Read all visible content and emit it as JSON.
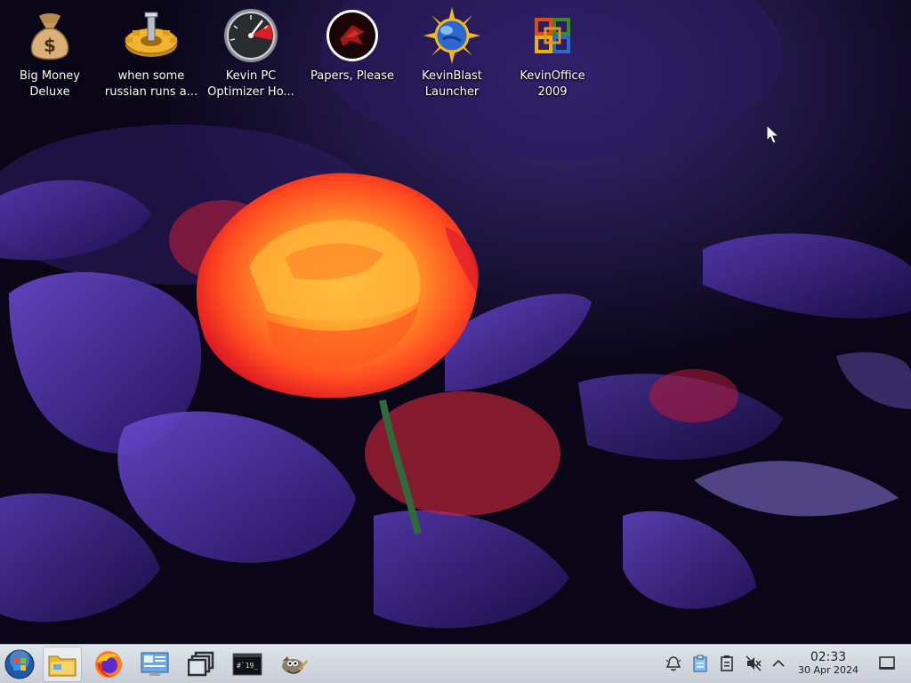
{
  "desktop": {
    "icons": [
      {
        "label": "Big Money\nDeluxe",
        "icon": "money-bag-icon"
      },
      {
        "label": "when some\nrussian runs a...",
        "icon": "gear-icon"
      },
      {
        "label": "Kevin PC\nOptimizer Ho...",
        "icon": "gauge-icon"
      },
      {
        "label": "Papers, Please",
        "icon": "seal-icon"
      },
      {
        "label": "KevinBlast\nLauncher",
        "icon": "sun-globe-icon"
      },
      {
        "label": "KevinOffice\n2009",
        "icon": "office-logo-icon"
      }
    ]
  },
  "taskbar": {
    "start": {
      "icon": "start-orb-icon"
    },
    "launchers": [
      {
        "icon": "file-manager-icon",
        "active": true
      },
      {
        "icon": "firefox-icon",
        "active": false
      },
      {
        "icon": "system-settings-icon",
        "active": false
      },
      {
        "icon": "window-switcher-icon",
        "active": false
      },
      {
        "icon": "terminal-icon",
        "active": false
      },
      {
        "icon": "gimp-icon",
        "active": false
      }
    ],
    "tray": [
      {
        "icon": "notifications-bell-icon"
      },
      {
        "icon": "clipboard-icon"
      },
      {
        "icon": "device-notifier-icon"
      },
      {
        "icon": "volume-muted-icon"
      },
      {
        "icon": "chevron-up-icon"
      }
    ],
    "clock": {
      "time": "02:33",
      "date": "30 Apr 2024"
    },
    "show_desktop": {
      "icon": "show-desktop-icon"
    }
  },
  "colors": {
    "taskbar_bg": "#d4d9e0",
    "wallpaper_leaf": "#4a2a9a",
    "rose": "#ff5a1e"
  }
}
